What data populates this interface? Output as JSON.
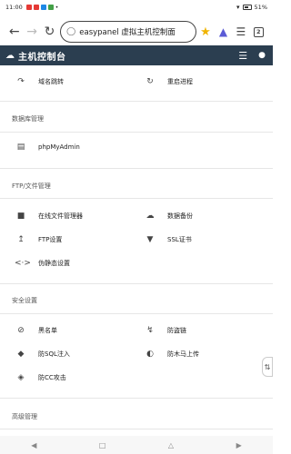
{
  "status": {
    "time": "11:00",
    "battery": "51%"
  },
  "browser": {
    "url": "easypanel 虚拟主机控制面",
    "tab_count": "2"
  },
  "header": {
    "title": "主机控制台"
  },
  "items": {
    "domain_redirect": "域名跳转",
    "restart_process": "重启进程",
    "phpmyadmin": "phpMyAdmin",
    "file_manager": "在线文件管理器",
    "data_backup": "数据备份",
    "ftp_settings": "FTP设置",
    "ssl_cert": "SSL证书",
    "pseudo_static": "伪静态设置",
    "blacklist": "黑名单",
    "anti_leech": "防盗链",
    "anti_sql": "防SQL注入",
    "anti_trojan": "防木马上传",
    "anti_cc": "防CC攻击"
  },
  "sections": {
    "db": "数据库管理",
    "ftp": "FTP/文件管理",
    "security": "安全设置",
    "advanced": "高级管理"
  }
}
